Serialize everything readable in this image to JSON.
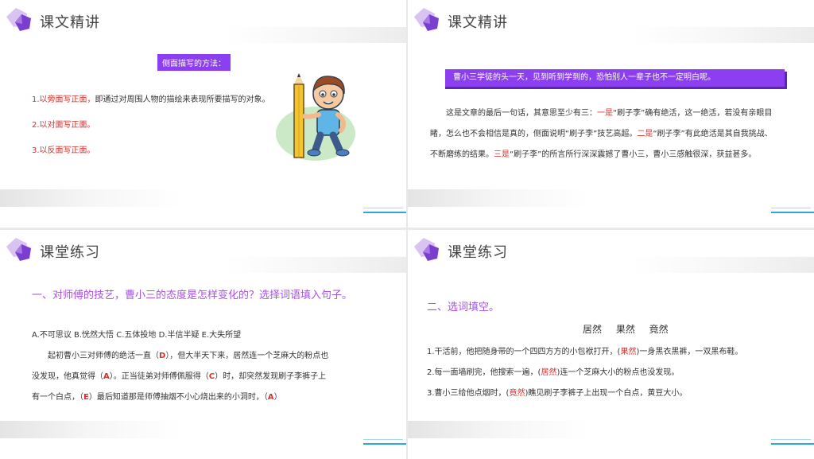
{
  "slide1": {
    "title": "课文精讲",
    "label": "侧面描写的方法：",
    "items": [
      {
        "red": "1.以旁面写正面，",
        "rest": "即通过对周围人物的描绘来表现所要描写的对象。"
      },
      {
        "red": "2.以对面写正面。",
        "rest": ""
      },
      {
        "red": "3.以反面写正面。",
        "rest": ""
      }
    ]
  },
  "slide2": {
    "title": "课文精讲",
    "quote": "曹小三学徒的头一天，见到听到学到的，恐怕别人一辈子也不一定明白呢。",
    "p_a": "这是文章的最后一句话，其意思至少有三：",
    "m1": "一是",
    "p_b": "“刷子李”确有绝活，这一绝活，若没有亲眼目睹，怎么也不会相信是真的，侧面说明“刷子李”技艺高超。",
    "m2": "二是",
    "p_c": "“刷子李”有此绝活是其自我挑战、不断磨练的结果。",
    "m3": "三是",
    "p_d": "“刷子李”的所言所行深深震撼了曹小三，曹小三感触很深，获益甚多。"
  },
  "slide3": {
    "title": "课堂练习",
    "heading": "一、对师傅的技艺，曹小三的态度是怎样变化的？选择词语填入句子。",
    "options": "A.不可思议  B.恍然大悟  C.五体投地  D.半信半疑  E.大失所望",
    "line1_a": "起初曹小三对师傅的绝活一直（",
    "a1": "D",
    "line1_b": "），但大半天下来，居然连一个芝麻大的粉点也",
    "line2_a": "没发现，他真觉得（",
    "a2": "A",
    "line2_b": "）。正当徒弟对师傅佩服得（",
    "a3": "C",
    "line2_c": "）时，却突然发现刷子李裤子上",
    "line3_a": "有一个白点，（",
    "a4": "E",
    "line3_b": "）最后知道那是师傅抽烟不小心烧出来的小洞时，（",
    "a5": "A",
    "line3_c": "）"
  },
  "slide4": {
    "title": "课堂练习",
    "heading": "二、选词填空。",
    "words": "居然  果然  竟然",
    "q1_a": "1.干活前，他把随身带的一个四四方方的小包袱打开，(",
    "q1_ans": "果然",
    "q1_b": ")一身黑衣黑裤，一双黑布鞋。",
    "q2_a": "2.每一面墙刷完，他搜索一遍，(",
    "q2_ans": "居然",
    "q2_b": ")连一个芝麻大小的粉点也没发现。",
    "q3_a": "3.曹小三给他点烟时，(",
    "q3_ans": "竟然",
    "q3_b": ")瞧见刷子李裤子上出现一个白点，黄豆大小。"
  },
  "colors": {
    "accent": "#8c3ff0",
    "heading": "#a94fe6",
    "answer": "#d2322d",
    "line": "#2ea6e0"
  }
}
